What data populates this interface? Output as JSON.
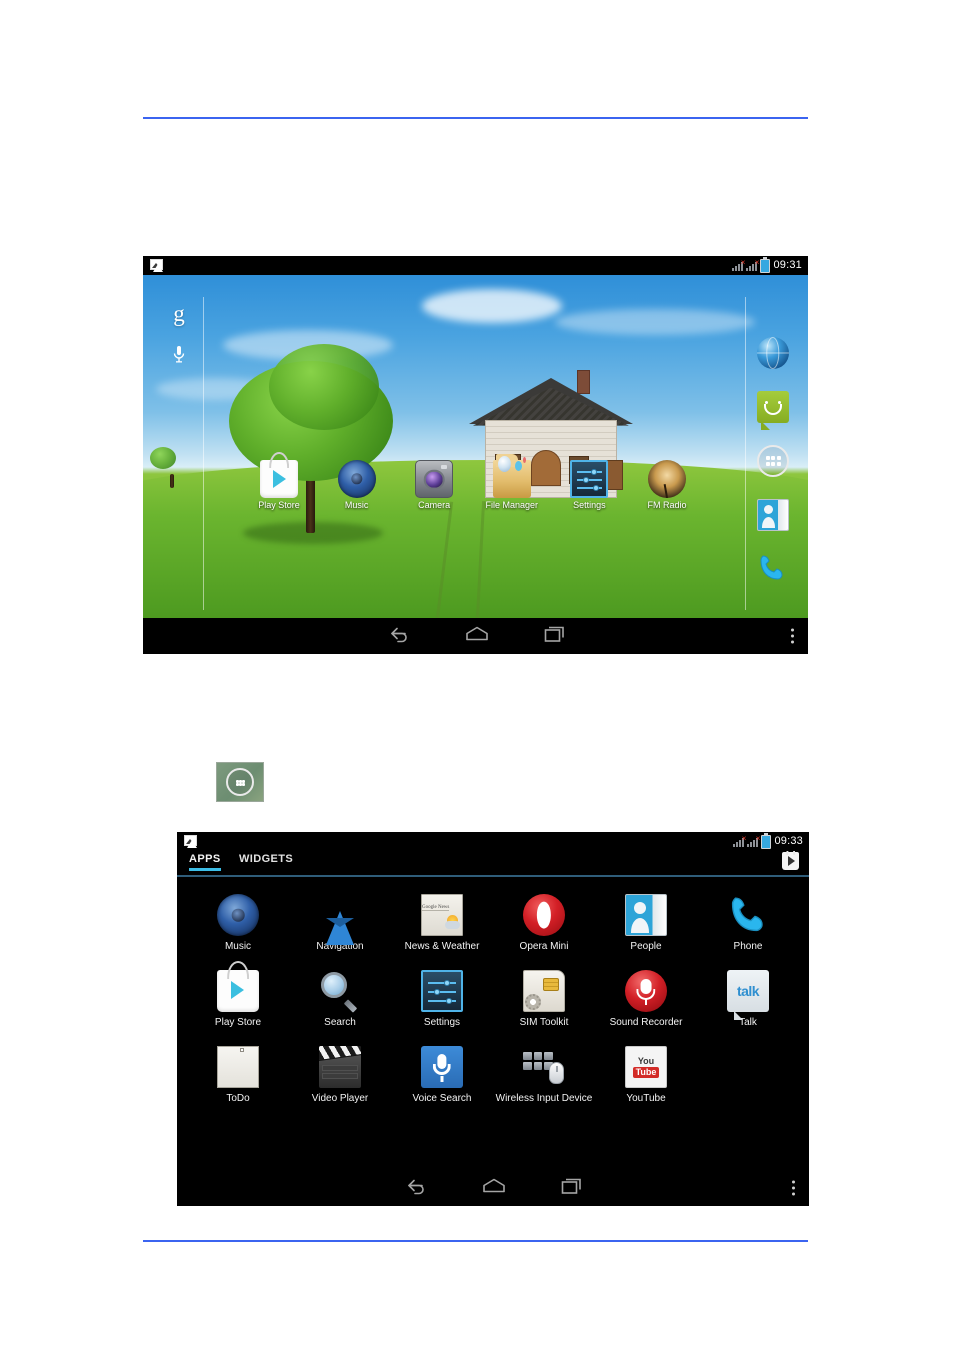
{
  "page": {
    "rule_color": "#3b64f0"
  },
  "home_screen": {
    "name": "android-home-screen",
    "status_bar": {
      "notification_icon": "screenshot-icon",
      "signal_icon_1": "signal-bars-no-sim-icon",
      "signal_icon_2": "signal-bars-no-sim-icon",
      "battery_icon": "battery-icon",
      "clock": "09:31"
    },
    "search_widget": {
      "logo": "google-g-logo",
      "mic": "microphone-icon"
    },
    "shortcuts": [
      {
        "label": "Play Store",
        "icon": "play-store-icon"
      },
      {
        "label": "Music",
        "icon": "music-speaker-icon"
      },
      {
        "label": "Camera",
        "icon": "camera-icon"
      },
      {
        "label": "File Manager",
        "icon": "file-manager-icon"
      },
      {
        "label": "Settings",
        "icon": "settings-sliders-icon"
      },
      {
        "label": "FM Radio",
        "icon": "fm-radio-icon"
      }
    ],
    "right_rail": [
      {
        "label": "Browser",
        "icon": "browser-globe-icon"
      },
      {
        "label": "Messaging",
        "icon": "messaging-smiley-icon"
      },
      {
        "label": "All Apps",
        "icon": "all-apps-grid-icon"
      },
      {
        "label": "People",
        "icon": "people-contacts-icon"
      },
      {
        "label": "Phone",
        "icon": "phone-handset-icon"
      }
    ],
    "nav_bar": {
      "back": "back-icon",
      "home": "home-icon",
      "recents": "recents-icon",
      "overflow": "overflow-menu-icon"
    }
  },
  "inline_figure": {
    "name": "all-apps-button-figure",
    "icon": "all-apps-grid-icon"
  },
  "apps_screen": {
    "name": "android-all-apps-drawer",
    "status_bar": {
      "notification_icon": "screenshot-icon",
      "signal_icon_1": "signal-bars-no-sim-icon",
      "signal_icon_2": "signal-bars-no-sim-icon",
      "battery_icon": "battery-icon",
      "clock": "09:33"
    },
    "tabs": [
      {
        "label": "APPS",
        "selected": true
      },
      {
        "label": "WIDGETS",
        "selected": false
      }
    ],
    "tab_indicator_color": "#3cbde6",
    "shop_button": "play-store-shop-icon",
    "rows": [
      [
        {
          "label": "Music",
          "icon": "music-speaker-icon"
        },
        {
          "label": "Navigation",
          "icon": "navigation-arrow-icon"
        },
        {
          "label": "News & Weather",
          "icon": "news-weather-icon"
        },
        {
          "label": "Opera Mini",
          "icon": "opera-mini-icon"
        },
        {
          "label": "People",
          "icon": "people-contacts-icon"
        },
        {
          "label": "Phone",
          "icon": "phone-handset-icon"
        }
      ],
      [
        {
          "label": "Play Store",
          "icon": "play-store-icon"
        },
        {
          "label": "Search",
          "icon": "search-magnifier-icon"
        },
        {
          "label": "Settings",
          "icon": "settings-sliders-icon"
        },
        {
          "label": "SIM Toolkit",
          "icon": "sim-toolkit-icon"
        },
        {
          "label": "Sound Recorder",
          "icon": "sound-recorder-icon"
        },
        {
          "label": "Talk",
          "icon": "google-talk-icon"
        }
      ],
      [
        {
          "label": "ToDo",
          "icon": "todo-list-icon"
        },
        {
          "label": "Video Player",
          "icon": "video-player-clapper-icon"
        },
        {
          "label": "Voice Search",
          "icon": "voice-search-mic-icon"
        },
        {
          "label": "Wireless Input Device",
          "icon": "wireless-input-device-icon"
        },
        {
          "label": "YouTube",
          "icon": "youtube-icon"
        }
      ]
    ],
    "nav_bar": {
      "back": "back-icon",
      "home": "home-icon",
      "recents": "recents-icon",
      "overflow": "overflow-menu-icon"
    }
  }
}
